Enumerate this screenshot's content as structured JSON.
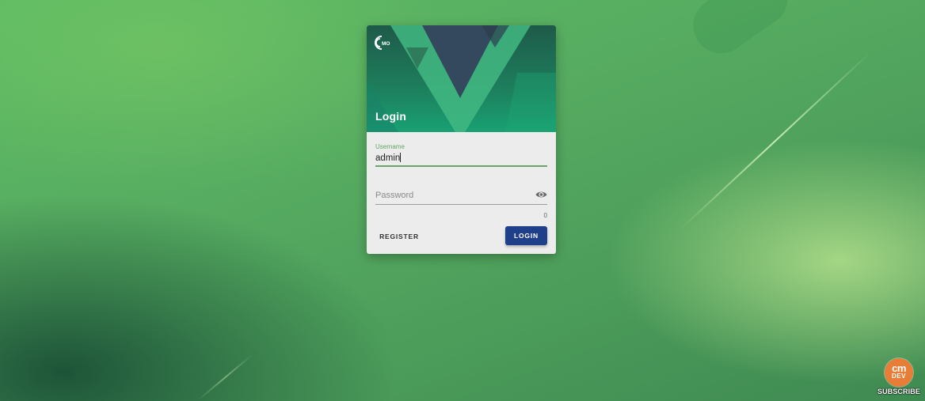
{
  "login_card": {
    "brand_logo_text": "CMO",
    "title": "Login",
    "username": {
      "label": "Username",
      "value": "admin"
    },
    "password": {
      "placeholder": "Password",
      "char_count": "0",
      "toggle_icon": "eye-icon"
    },
    "register_label": "REGISTER",
    "login_label": "LOGIN"
  },
  "channel_badge": {
    "logo_line1": "cm",
    "logo_line2": "DEV",
    "subscribe_label": "SUBSCRIBE"
  },
  "colors": {
    "primary_button": "#1f3f8a",
    "field_focus": "#6aa56b",
    "card_surface": "#ececec",
    "hero_green": "#1d7f5d",
    "badge_orange": "#e77d36"
  }
}
